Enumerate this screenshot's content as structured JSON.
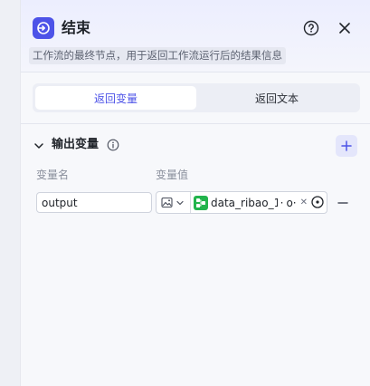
{
  "node": {
    "title": "结束",
    "description": "工作流的最终节点，用于返回工作流运行后的结果信息",
    "icon": "end-node-icon",
    "accent_color": "#4d53e8"
  },
  "tabs": [
    {
      "label": "返回变量",
      "active": true
    },
    {
      "label": "返回文本",
      "active": false
    }
  ],
  "output_section": {
    "title": "输出变量",
    "columns": {
      "name": "变量名",
      "value": "变量值"
    },
    "rows": [
      {
        "name": "output",
        "value_type_icon": "image-icon",
        "reference": {
          "node": "data_ribao_1",
          "separator": "·",
          "tail": "o·",
          "icon_color": "#22b44c"
        }
      }
    ]
  }
}
